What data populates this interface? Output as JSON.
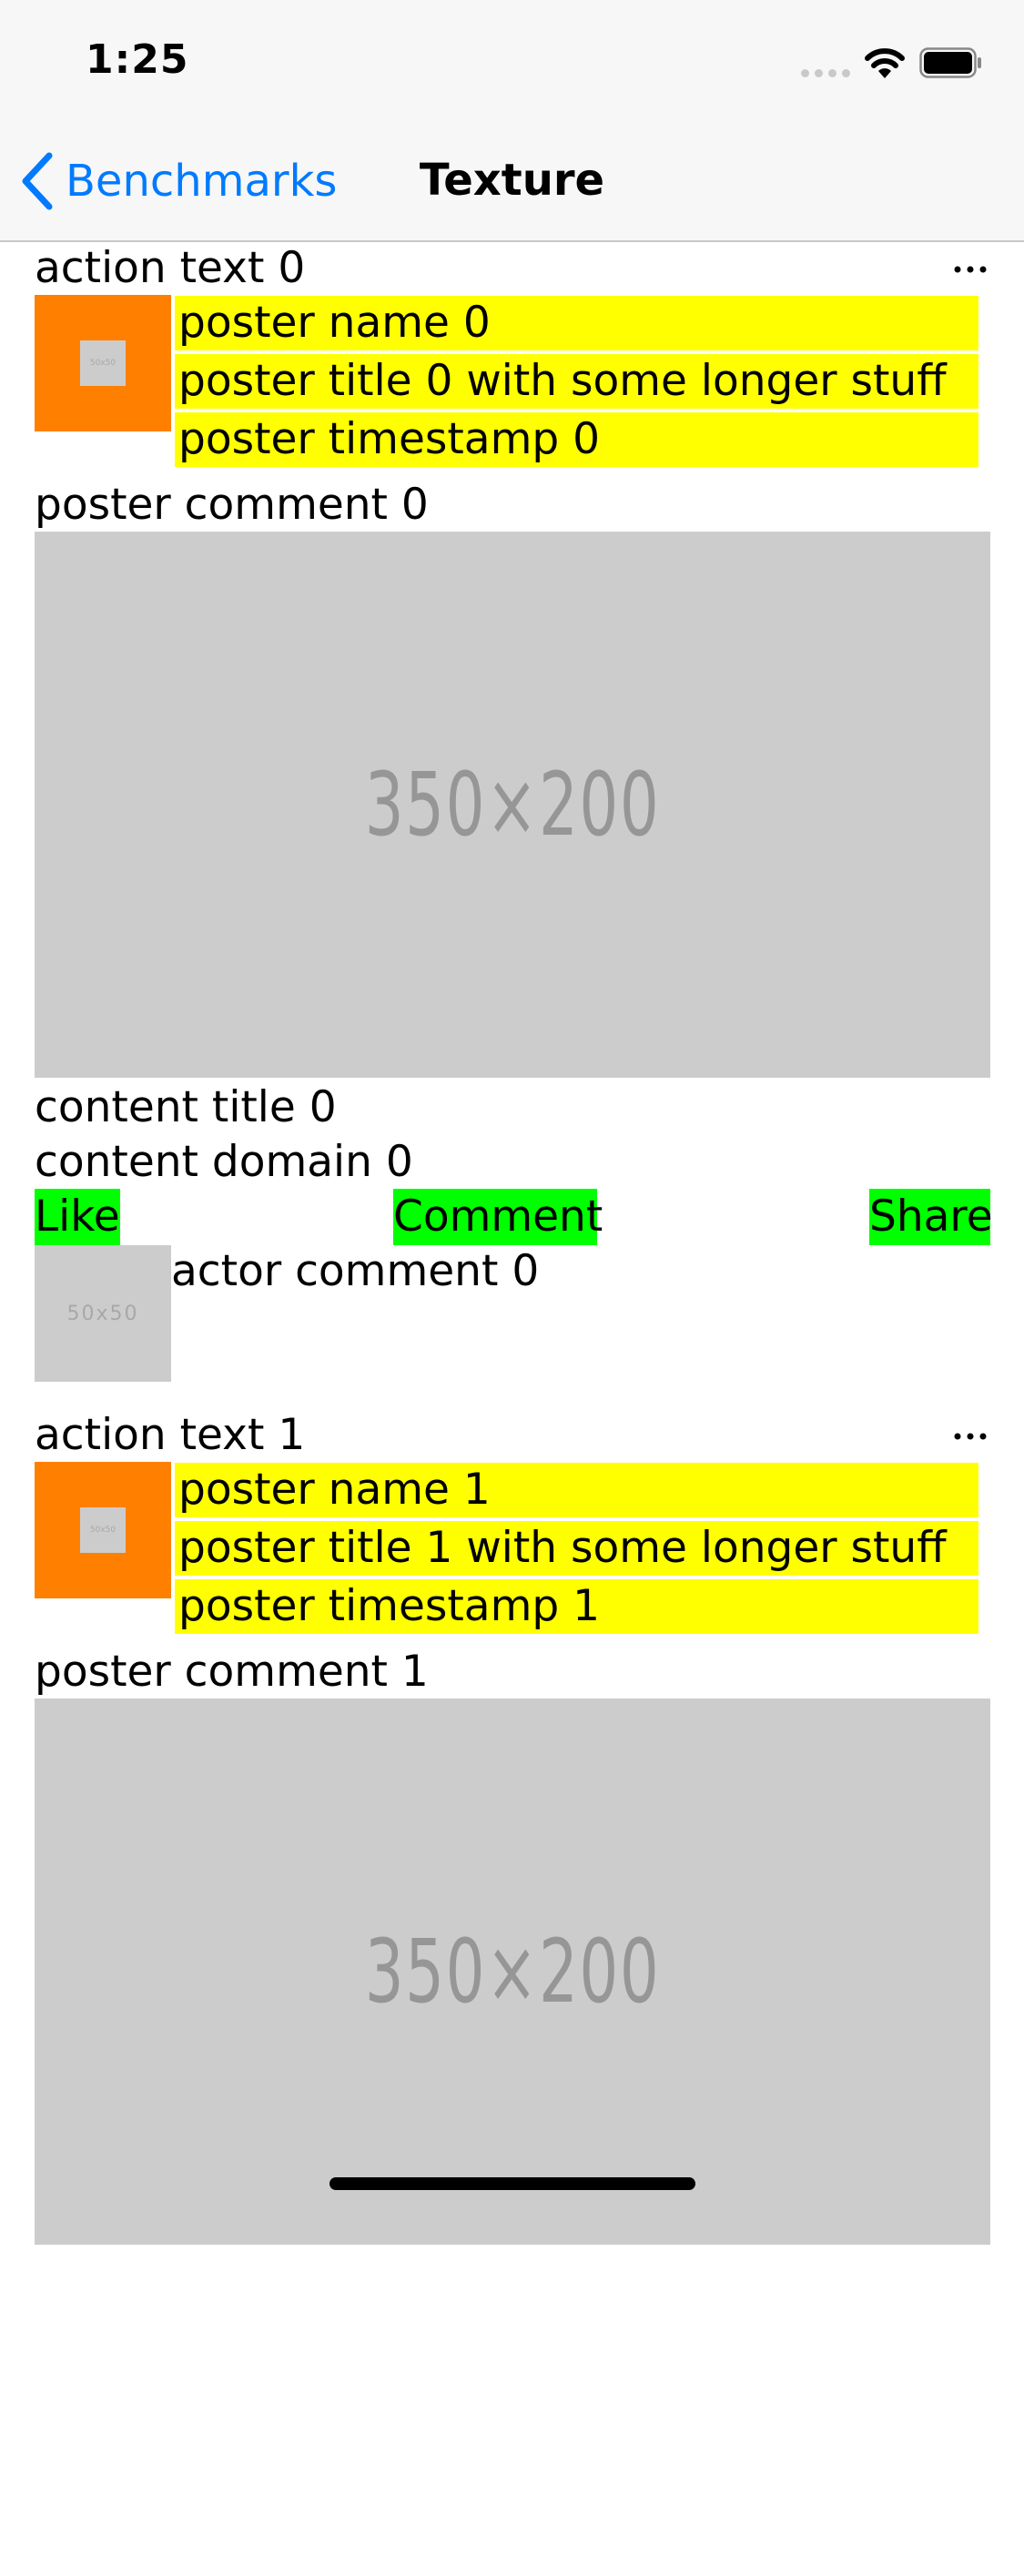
{
  "status_bar": {
    "time": "1:25",
    "icons": [
      "cellular-signal-icon",
      "wifi-icon",
      "battery-icon"
    ]
  },
  "nav_bar": {
    "back_label": "Benchmarks",
    "title": "Texture"
  },
  "colors": {
    "accent": "#007aff",
    "avatar_bg": "#ff7f00",
    "poster_field_bg": "#ffff00",
    "action_button_bg": "#00ff00",
    "placeholder_bg": "#cccccc"
  },
  "feed": {
    "items": [
      {
        "action_text": "action text 0",
        "more_label": "...",
        "avatar_placeholder": "50x50",
        "poster_name": "poster name 0",
        "poster_title": "poster title 0 with some longer stuff",
        "poster_timestamp": "poster timestamp 0",
        "poster_comment": "poster comment 0",
        "content_image_label": "350×200",
        "content_title": "content title 0",
        "content_domain": "content domain 0",
        "like_label": "Like",
        "comment_label": "Comment",
        "share_label": "Share",
        "actor_avatar_label": "50x50",
        "actor_comment": "actor comment 0"
      },
      {
        "action_text": "action text 1",
        "more_label": "...",
        "avatar_placeholder": "50x50",
        "poster_name": "poster name 1",
        "poster_title": "poster title 1 with some longer stuff",
        "poster_timestamp": "poster timestamp 1",
        "poster_comment": "poster comment 1",
        "content_image_label": "350×200"
      }
    ]
  }
}
